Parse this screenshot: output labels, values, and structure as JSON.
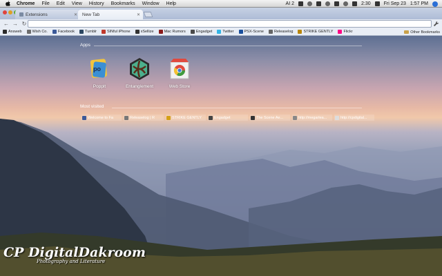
{
  "menubar": {
    "items": [
      "Chrome",
      "File",
      "Edit",
      "View",
      "History",
      "Bookmarks",
      "Window",
      "Help"
    ],
    "status": [
      "AI 2",
      "2:30",
      "Fri Sep 23",
      "1:57 PM"
    ]
  },
  "tabs": [
    {
      "label": "Extensions"
    },
    {
      "label": "New Tab"
    }
  ],
  "omnibox": {
    "value": ""
  },
  "bookmarks": {
    "items": [
      {
        "label": "Answeb",
        "color": "#2b2b2b"
      },
      {
        "label": "Wish Co.",
        "color": "#6d6d6d"
      },
      {
        "label": "Facebook",
        "color": "#3b5998"
      },
      {
        "label": "Tumblr",
        "color": "#2c4762"
      },
      {
        "label": "SINful iPhone",
        "color": "#c0392b"
      },
      {
        "label": "xSellize",
        "color": "#333"
      },
      {
        "label": "Mac Rumors",
        "color": "#8a1c1c"
      },
      {
        "label": "Engadget",
        "color": "#4a4a4a"
      },
      {
        "label": "Twitter",
        "color": "#33b5e5"
      },
      {
        "label": "PSX-Scene",
        "color": "#1a4f9c"
      },
      {
        "label": "Releaselog",
        "color": "#666"
      },
      {
        "label": "STRIKE GENTLY",
        "color": "#b8860b"
      },
      {
        "label": "Flickr",
        "color": "#ff0084"
      }
    ],
    "other": "Other Bookmarks"
  },
  "apps": {
    "title": "Apps",
    "items": [
      {
        "label": "Popplt",
        "icon": "popplt-icon"
      },
      {
        "label": "Entanglement",
        "icon": "entanglement-icon"
      },
      {
        "label": "Web Store",
        "icon": "web-store-icon"
      }
    ]
  },
  "most_visited": {
    "title": "Most visited",
    "items": [
      {
        "label": "Welcome to Fa",
        "color": "#3b5998"
      },
      {
        "label": "Releaselog | R",
        "color": "#777"
      },
      {
        "label": "STRIKE GENTLY",
        "color": "#d4a017"
      },
      {
        "label": "Engadget",
        "color": "#444"
      },
      {
        "label": "The Scene Ae...",
        "color": "#333"
      },
      {
        "label": "http://megarlea...",
        "color": "#888"
      },
      {
        "label": "http://cpdigital...",
        "color": "#ddd"
      }
    ]
  },
  "watermark": {
    "title": "CP DigitalDakroom",
    "subtitle": "Photography and Literature"
  }
}
